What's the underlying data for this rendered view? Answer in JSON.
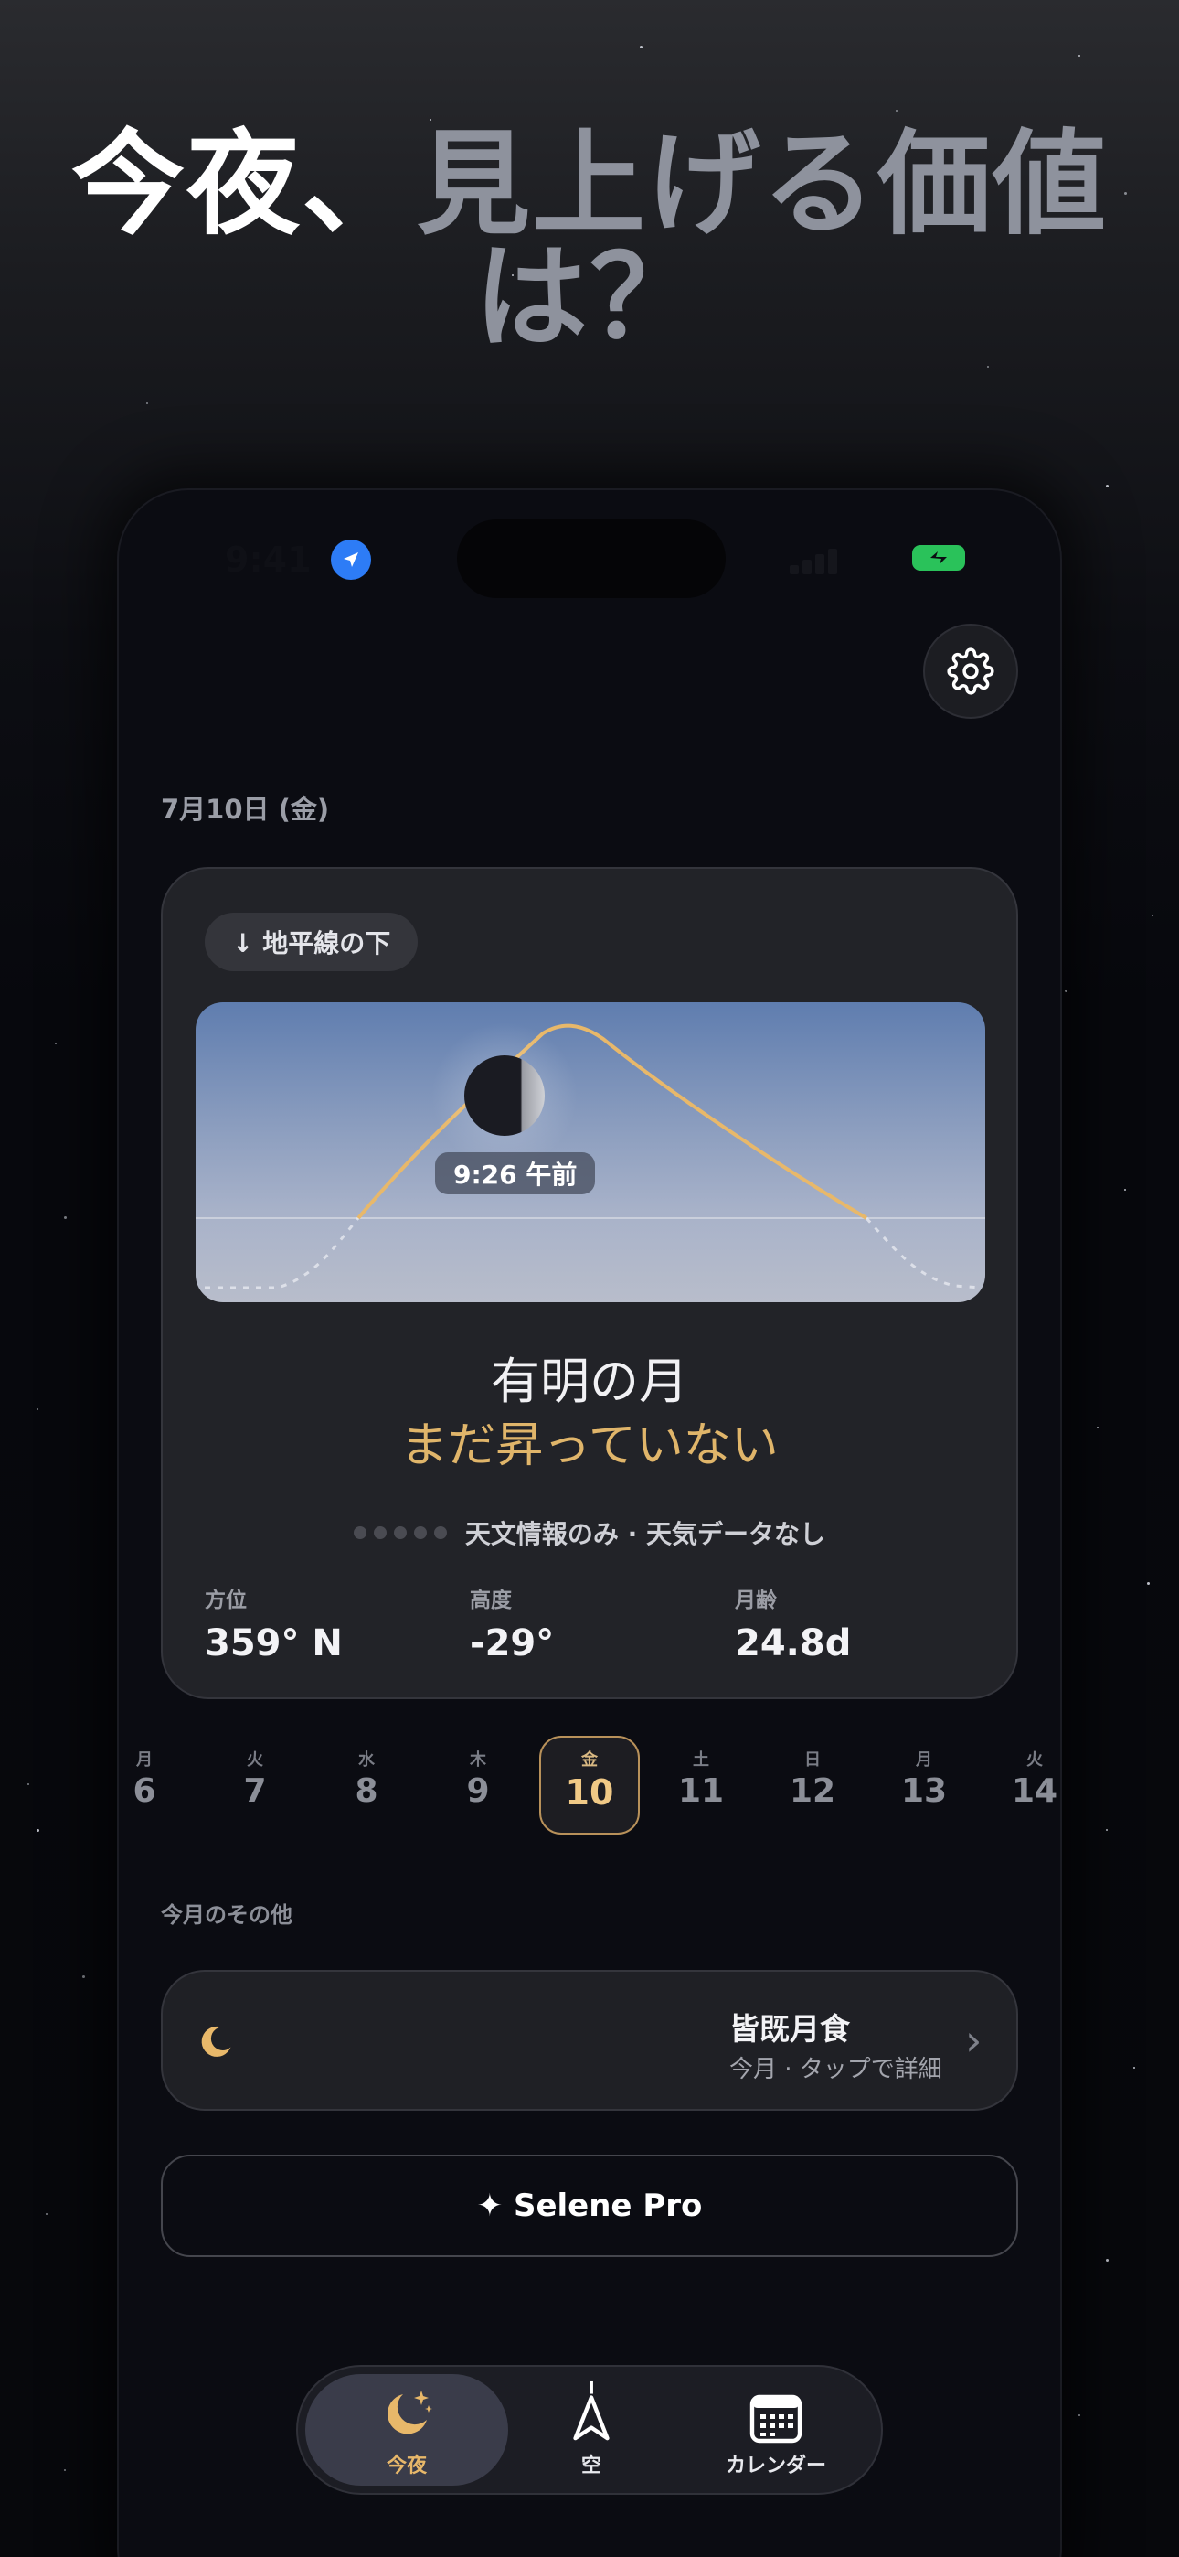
{
  "headline": {
    "white": "今夜、",
    "gray": "見上げる価値は？"
  },
  "status_bar": {
    "time": "9:41"
  },
  "date": "7月10日 (金)",
  "moon_card": {
    "badge": "↓ 地平線の下",
    "time_label": "9:26 午前",
    "moon_name": "有明の月",
    "status": "まだ昇っていない",
    "info": "天文情報のみ · 天気データなし",
    "stats": [
      {
        "label": "方位",
        "value": "359° N"
      },
      {
        "label": "高度",
        "value": "-29°"
      },
      {
        "label": "月齢",
        "value": "24.8d"
      }
    ]
  },
  "days": [
    {
      "weekday": "月",
      "num": "6"
    },
    {
      "weekday": "火",
      "num": "7"
    },
    {
      "weekday": "水",
      "num": "8"
    },
    {
      "weekday": "木",
      "num": "9"
    },
    {
      "weekday": "金",
      "num": "10",
      "selected": true
    },
    {
      "weekday": "土",
      "num": "11"
    },
    {
      "weekday": "日",
      "num": "12"
    },
    {
      "weekday": "月",
      "num": "13"
    },
    {
      "weekday": "火",
      "num": "14"
    }
  ],
  "month_section": {
    "label": "今月のその他"
  },
  "event": {
    "title": "皆既月食",
    "subtitle": "今月 · タップで詳細",
    "icon": "crescent-moon-icon"
  },
  "pro_button": {
    "label": "✦ Selene Pro"
  },
  "tabs": [
    {
      "label": "今夜",
      "icon": "moon-stars-icon",
      "active": true
    },
    {
      "label": "空",
      "icon": "compass-arrow-icon"
    },
    {
      "label": "カレンダー",
      "icon": "calendar-icon"
    }
  ],
  "colors": {
    "accent": "#e8b86a",
    "background": "#07080c",
    "card": "#222328",
    "sky_top": "#5f7daf"
  }
}
